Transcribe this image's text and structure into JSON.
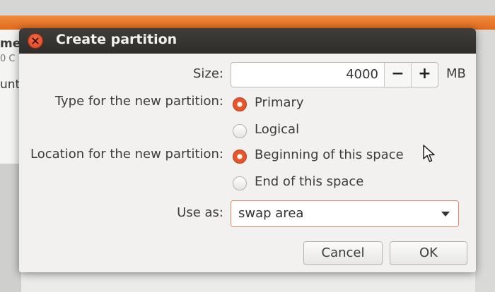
{
  "background": {
    "title_fragment": "me",
    "sub_fragment": "0 C",
    "side_fragment": "unt"
  },
  "dialog": {
    "title": "Create partition",
    "size_label": "Size:",
    "size_value": "4000",
    "decrement_label": "−",
    "increment_label": "+",
    "unit": "MB",
    "type_label": "Type for the new partition:",
    "type_options": [
      {
        "label": "Primary",
        "selected": true
      },
      {
        "label": "Logical",
        "selected": false
      }
    ],
    "location_label": "Location for the new partition:",
    "location_options": [
      {
        "label": "Beginning of this space",
        "selected": true
      },
      {
        "label": "End of this space",
        "selected": false
      }
    ],
    "use_as_label": "Use as:",
    "use_as_value": "swap area",
    "cancel_label": "Cancel",
    "ok_label": "OK"
  },
  "colors": {
    "accent": "#e9552b",
    "titlebar": "#3a3935",
    "orange_bar": "#e8772e"
  }
}
